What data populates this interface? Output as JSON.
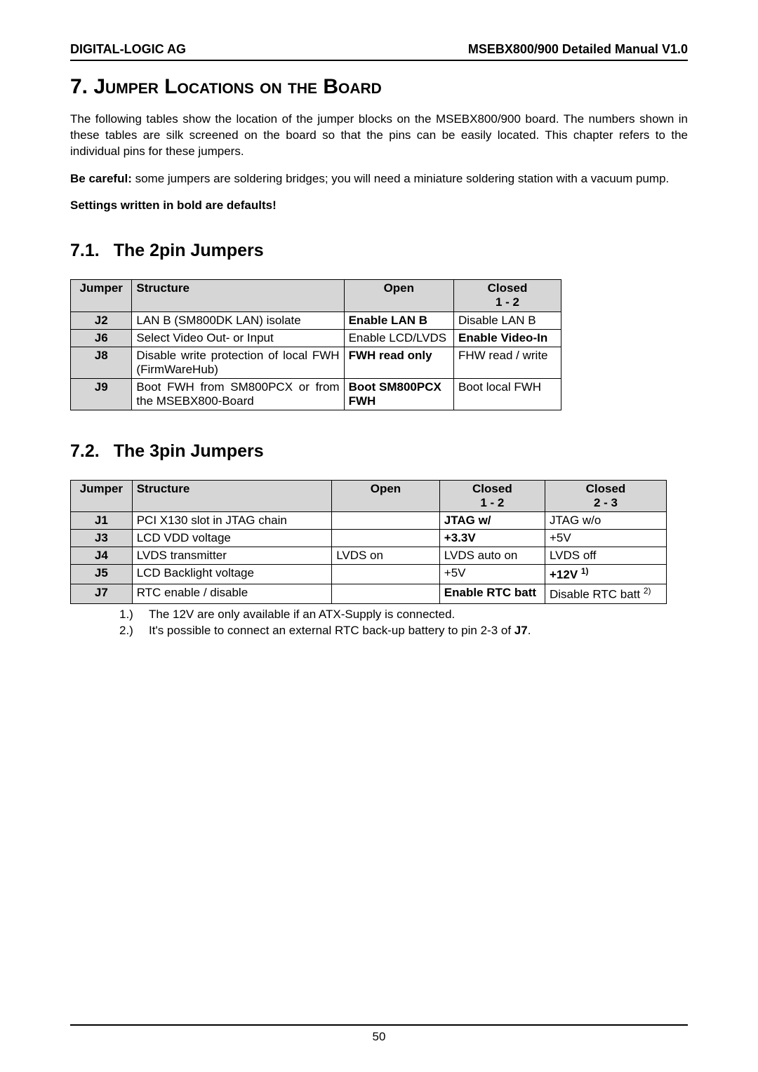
{
  "header": {
    "left": "DIGITAL-LOGIC AG",
    "right": "MSEBX800/900 Detailed Manual V1.0"
  },
  "chapter": {
    "number": "7.",
    "title": "Jumper Locations on the Board"
  },
  "intro": {
    "para1": "The following tables show the location of the jumper blocks on the MSEBX800/900 board. The numbers shown in these tables are silk screened on the board so that the pins can be easily located. This chapter refers to the individual pins for these jumpers.",
    "para2_prefix": "Be careful:",
    "para2_rest": " some jumpers are soldering bridges; you will need a miniature soldering station with a vacuum pump.",
    "defaults": "Settings written in bold are defaults!"
  },
  "section1": {
    "number": "7.1.",
    "title": "The 2pin Jumpers",
    "headers": {
      "jumper": "Jumper",
      "structure": "Structure",
      "open": "Open",
      "closed": "Closed",
      "closed_sub": "1 - 2"
    },
    "rows": [
      {
        "j": "J2",
        "struct": "LAN B (SM800DK LAN) isolate",
        "open": "Enable LAN B",
        "open_bold": true,
        "closed": "Disable LAN B",
        "closed_bold": false
      },
      {
        "j": "J6",
        "struct": "Select Video Out- or Input",
        "open": "Enable LCD/LVDS",
        "open_bold": false,
        "closed": "Enable Video-In",
        "closed_bold": true
      },
      {
        "j": "J8",
        "struct": "Disable write protection of local FWH (FirmWareHub)",
        "open": "FWH read only",
        "open_bold": true,
        "closed": "FHW read / write",
        "closed_bold": false
      },
      {
        "j": "J9",
        "struct": "Boot FWH from SM800PCX or from the MSEBX800-Board",
        "open": "Boot SM800PCX FWH",
        "open_bold": true,
        "closed": "Boot local FWH",
        "closed_bold": false
      }
    ]
  },
  "section2": {
    "number": "7.2.",
    "title": "The 3pin Jumpers",
    "headers": {
      "jumper": "Jumper",
      "structure": "Structure",
      "open": "Open",
      "closed12": "Closed",
      "closed12_sub": "1 - 2",
      "closed23": "Closed",
      "closed23_sub": "2 - 3"
    },
    "rows": [
      {
        "j": "J1",
        "struct": "PCI X130 slot in JTAG chain",
        "open": "",
        "c12": "JTAG w/",
        "c12_bold": true,
        "c23": "JTAG w/o",
        "c23_bold": false,
        "c23_sup": ""
      },
      {
        "j": "J3",
        "struct": "LCD VDD voltage",
        "open": "",
        "c12": "+3.3V",
        "c12_bold": true,
        "c23": "+5V",
        "c23_bold": false,
        "c23_sup": ""
      },
      {
        "j": "J4",
        "struct": "LVDS transmitter",
        "open": "LVDS on",
        "c12": "LVDS auto on",
        "c12_bold": false,
        "c23": "LVDS off",
        "c23_bold": false,
        "c23_sup": ""
      },
      {
        "j": "J5",
        "struct": "LCD Backlight voltage",
        "open": "",
        "c12": "+5V",
        "c12_bold": false,
        "c23": "+12V ",
        "c23_bold": true,
        "c23_sup": "1)"
      },
      {
        "j": "J7",
        "struct": "RTC enable / disable",
        "open": "",
        "c12": "Enable RTC batt",
        "c12_bold": true,
        "c23": "Disable RTC batt ",
        "c23_bold": false,
        "c23_sup": "2)"
      }
    ],
    "notes": [
      {
        "marker": "1.)",
        "text_a": "The 12V are only available if an ATX-Supply is connected.",
        "bold": "",
        "text_b": ""
      },
      {
        "marker": "2.)",
        "text_a": "It's possible to connect an external RTC back-up battery to pin 2-3 of ",
        "bold": "J7",
        "text_b": "."
      }
    ]
  },
  "page_number": "50",
  "chart_data": {
    "type": "table",
    "tables": [
      {
        "name": "2pin Jumpers",
        "columns": [
          "Jumper",
          "Structure",
          "Open",
          "Closed 1-2"
        ],
        "rows": [
          [
            "J2",
            "LAN B (SM800DK LAN) isolate",
            "Enable LAN B",
            "Disable LAN B"
          ],
          [
            "J6",
            "Select Video Out- or Input",
            "Enable LCD/LVDS",
            "Enable Video-In"
          ],
          [
            "J8",
            "Disable write protection of local FWH (FirmWareHub)",
            "FWH read only",
            "FHW read / write"
          ],
          [
            "J9",
            "Boot FWH from SM800PCX or from the MSEBX800-Board",
            "Boot SM800PCX FWH",
            "Boot local FWH"
          ]
        ]
      },
      {
        "name": "3pin Jumpers",
        "columns": [
          "Jumper",
          "Structure",
          "Open",
          "Closed 1-2",
          "Closed 2-3"
        ],
        "rows": [
          [
            "J1",
            "PCI X130 slot in JTAG chain",
            "",
            "JTAG w/",
            "JTAG w/o"
          ],
          [
            "J3",
            "LCD VDD voltage",
            "",
            "+3.3V",
            "+5V"
          ],
          [
            "J4",
            "LVDS transmitter",
            "LVDS on",
            "LVDS auto on",
            "LVDS off"
          ],
          [
            "J5",
            "LCD Backlight voltage",
            "",
            "+5V",
            "+12V"
          ],
          [
            "J7",
            "RTC enable / disable",
            "",
            "Enable RTC batt",
            "Disable RTC batt"
          ]
        ]
      }
    ]
  }
}
